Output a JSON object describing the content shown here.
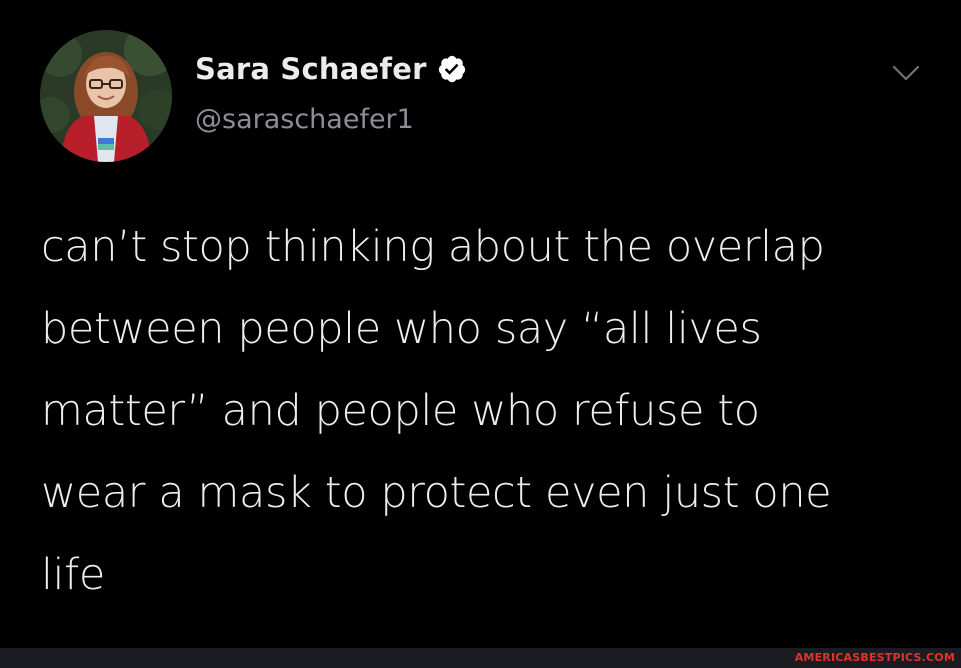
{
  "tweet": {
    "author": {
      "display_name": "Sara Schaefer",
      "handle": "@saraschaefer1",
      "verified": true,
      "avatar_icon": "profile-photo"
    },
    "text": "can’t stop thinking about the overlap\nbetween people who say “all lives\nmatter” and people who refuse to\nwear a mask to protect even just one\nlife",
    "menu_icon": "chevron-down-icon"
  },
  "footer": {
    "watermark": "AMERICASBESTPICS.COM"
  },
  "colors": {
    "background": "#000000",
    "text": "#eeeeee",
    "handle": "#8b8f95",
    "verified_badge": "#ffffff",
    "watermark": "#e0342a"
  }
}
